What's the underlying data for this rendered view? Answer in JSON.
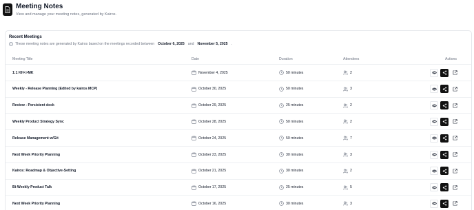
{
  "header": {
    "title": "Meeting Notes",
    "subtitle": "View and manage your meeting notes, generated by Kairos."
  },
  "card": {
    "title": "Recent Meetings",
    "desc_prefix": "These meeting notes are generated by Kairos based on the meetings recorded between",
    "date_from": "October 6, 2025",
    "date_joiner": "and",
    "date_to": "November 5, 2025",
    "desc_suffix": "."
  },
  "columns": {
    "title": "Meeting Title",
    "date": "Date",
    "duration": "Duration",
    "attendees": "Attendees",
    "actions": "Actions"
  },
  "meetings": [
    {
      "title": "1:1 KH<>MK",
      "date": "November 4, 2025",
      "duration": "50 minutes",
      "attendees": "2"
    },
    {
      "title": "Weekly - Release Planning (Edited by kairos MCP)",
      "date": "October 30, 2025",
      "duration": "50 minutes",
      "attendees": "3"
    },
    {
      "title": "Review - Persistent deck",
      "date": "October 29, 2025",
      "duration": "25 minutes",
      "attendees": "2"
    },
    {
      "title": "Weekly Product Strategy Sync",
      "date": "October 28, 2025",
      "duration": "50 minutes",
      "attendees": "2"
    },
    {
      "title": "Release Management w/Git",
      "date": "October 24, 2025",
      "duration": "50 minutes",
      "attendees": "7"
    },
    {
      "title": "Next Week Priority Planning",
      "date": "October 23, 2025",
      "duration": "30 minutes",
      "attendees": "3"
    },
    {
      "title": "Kairos: Roadmap & Objective-Setting",
      "date": "October 21, 2025",
      "duration": "30 minutes",
      "attendees": "2"
    },
    {
      "title": "Bi-Weekly Product Talk",
      "date": "October 17, 2025",
      "duration": "25 minutes",
      "attendees": "5"
    },
    {
      "title": "Next Week Priority Planning",
      "date": "October 16, 2025",
      "duration": "30 minutes",
      "attendees": "3"
    }
  ],
  "icons": {
    "app": "document-icon",
    "info": "info-icon",
    "date": "calendar-icon",
    "duration": "clock-icon",
    "attendees": "users-icon",
    "view": "eye-icon",
    "share": "share-icon",
    "open": "external-link-icon"
  },
  "colors": {
    "accent": "#111111",
    "muted_text": "#6b7280",
    "border": "#e5e7eb"
  }
}
